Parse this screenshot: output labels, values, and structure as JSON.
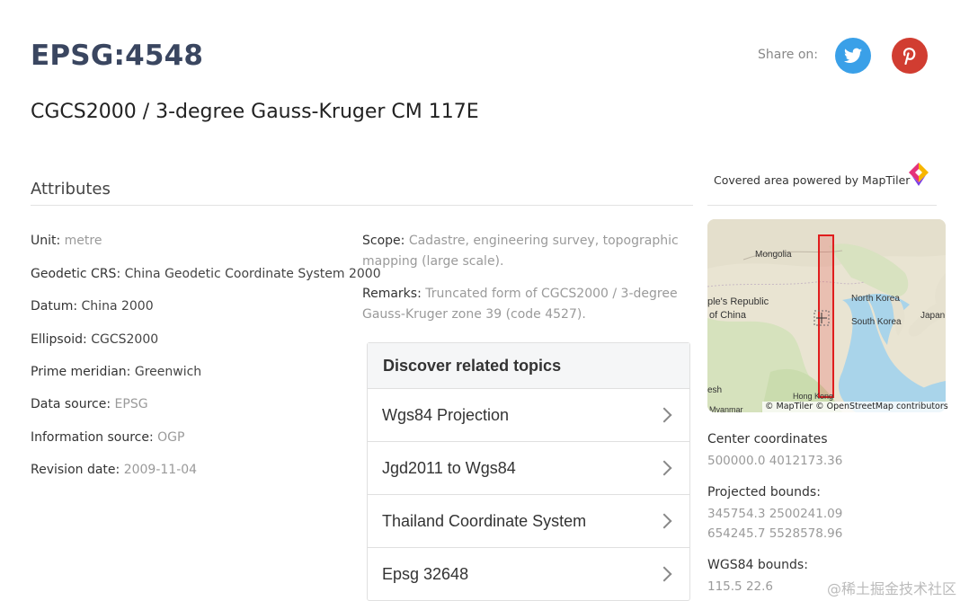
{
  "header": {
    "code": "EPSG:4548",
    "subtitle": "CGCS2000 / 3-degree Gauss-Kruger CM 117E",
    "share_label": "Share on:",
    "social": [
      {
        "name": "twitter",
        "icon": "twitter-bird-icon",
        "color": "#3aa0e8"
      },
      {
        "name": "pinterest",
        "icon": "pinterest-p-icon",
        "color": "#d13d31"
      }
    ]
  },
  "attributes": {
    "heading": "Attributes",
    "items": [
      {
        "key": "Unit:",
        "value": "metre"
      },
      {
        "key": "Geodetic CRS:",
        "value": "China Geodetic Coordinate System 2000"
      },
      {
        "key": "Datum:",
        "value": "China 2000"
      },
      {
        "key": "Ellipsoid:",
        "value": "CGCS2000"
      },
      {
        "key": "Prime meridian:",
        "value": "Greenwich"
      },
      {
        "key": "Data source:",
        "value": "EPSG"
      },
      {
        "key": "Information source:",
        "value": "OGP"
      },
      {
        "key": "Revision date:",
        "value": "2009-11-04"
      }
    ],
    "scope": {
      "key": "Scope:",
      "value": "Cadastre, engineering survey, topographic mapping (large scale)."
    },
    "remarks": {
      "key": "Remarks:",
      "value": "Truncated form of CGCS2000 / 3-degree Gauss-Kruger zone 39 (code 4527)."
    }
  },
  "related": {
    "heading": "Discover related topics",
    "topics": [
      "Wgs84 Projection",
      "Jgd2011 to Wgs84",
      "Thailand Coordinate System",
      "Epsg 32648"
    ]
  },
  "map": {
    "covered_label": "Covered area powered by MapTiler",
    "labels": {
      "mongolia": "Mongolia",
      "prc1": "ple's Republic",
      "prc2": "of China",
      "north_korea": "North Korea",
      "south_korea": "South Korea",
      "japan": "Japan",
      "hong_kong": "Hong Kong",
      "desh": "esh",
      "myanmar": "Myanmar"
    },
    "attribution": "© MapTiler © OpenStreetMap contributors"
  },
  "coordinates": {
    "center_label": "Center coordinates",
    "center_value": "500000.0 4012173.36",
    "projected_label": "Projected bounds:",
    "projected_line1": "345754.3 2500241.09",
    "projected_line2": "654245.7 5528578.96",
    "wgs84_label": "WGS84 bounds:",
    "wgs84_line1": "115.5 22.6"
  },
  "watermark": "@稀土掘金技术社区"
}
